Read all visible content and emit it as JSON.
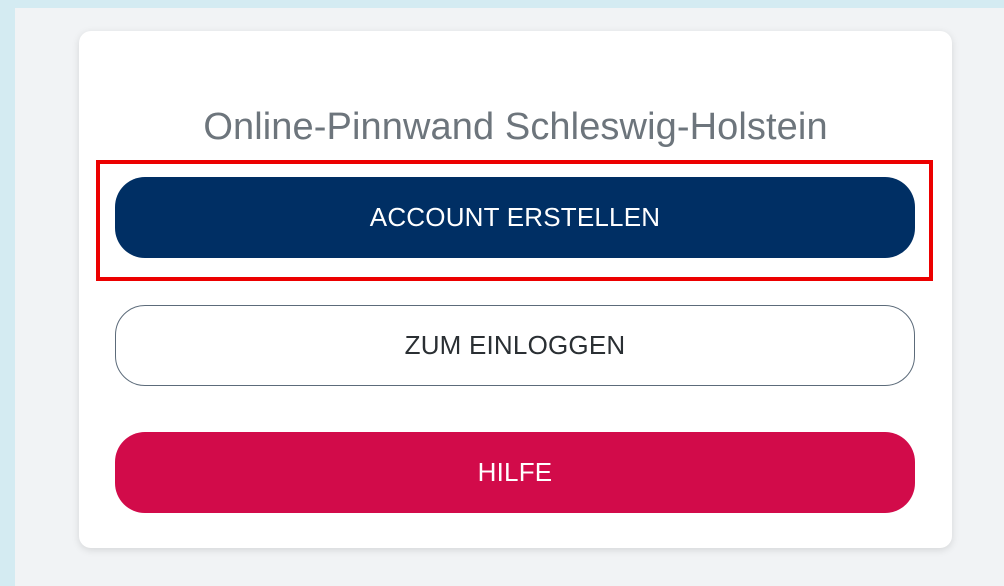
{
  "card": {
    "title": "Online-Pinnwand Schleswig-Holstein"
  },
  "buttons": {
    "create_account": "ACCOUNT ERSTELLEN",
    "login": "ZUM EINLOGGEN",
    "help": "HILFE"
  },
  "colors": {
    "background": "#d4ebf2",
    "page_area": "#f1f3f5",
    "primary": "#002f64",
    "danger": "#d20b4a",
    "highlight": "#ec0000"
  }
}
